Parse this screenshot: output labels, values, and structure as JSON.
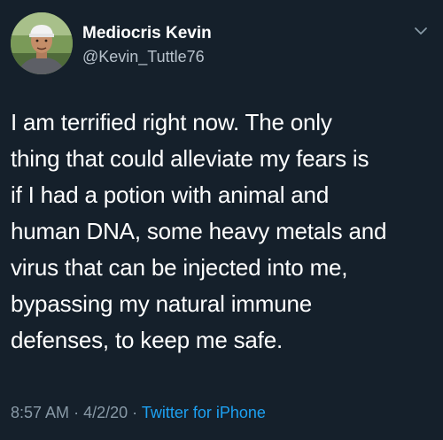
{
  "user": {
    "display_name": "Mediocris Kevin",
    "handle": "@Kevin_Tuttle76",
    "avatar_icon": "person-photo"
  },
  "tweet": {
    "text": "I am terrified right now. The only\nthing that could alleviate my fears is\nif I had a potion with animal and\nhuman DNA, some heavy metals and\nvirus that can be injected into me,\nbypassing my natural immune\ndefenses, to keep me safe.",
    "time": "8:57 AM",
    "date": "4/2/20",
    "separator": "·",
    "source": "Twitter for iPhone"
  },
  "colors": {
    "background": "#15202b",
    "text_primary": "#ffffff",
    "text_secondary": "#8899a6",
    "link": "#1da1f2"
  },
  "icons": {
    "menu": "chevron-down-icon"
  }
}
